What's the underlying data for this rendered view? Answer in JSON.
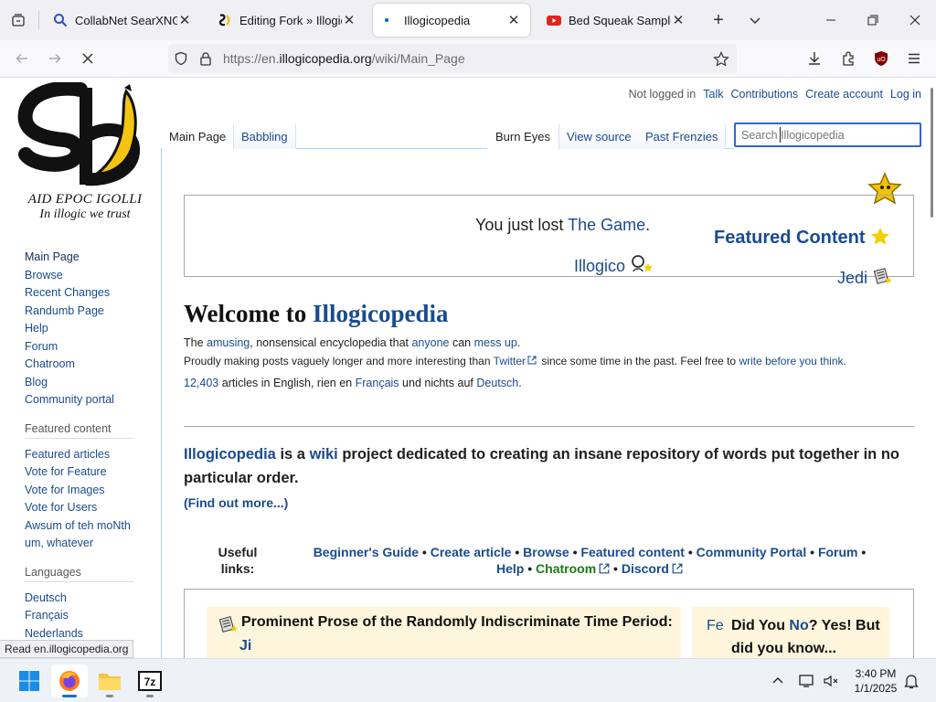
{
  "browser": {
    "tabs": [
      {
        "title": "CollabNet SearXNG",
        "icon": "search-favicon",
        "active": false
      },
      {
        "title": "Editing Fork » Illogicop",
        "icon": "illogicopedia-favicon",
        "active": false
      },
      {
        "title": "Illogicopedia",
        "icon": "loading-dot",
        "active": true
      },
      {
        "title": "Bed Squeak Sample [Je",
        "icon": "youtube-favicon",
        "active": false
      }
    ],
    "url_prefix": "https://en.",
    "url_domain": "illogicopedia.org",
    "url_path": "/wiki/Main_Page",
    "status_text": "Read en.illogicopedia.org"
  },
  "logo": {
    "line1": "AID EPOC IGOLLI",
    "line2": "In illogic we trust"
  },
  "user_links": {
    "not_logged_in": "Not logged in",
    "talk": "Talk",
    "contributions": "Contributions",
    "create_account": "Create account",
    "log_in": "Log in"
  },
  "content_tabs": {
    "main_page": "Main Page",
    "babbling": "Babbling",
    "burn_eyes": "Burn Eyes",
    "view_source": "View source",
    "past_frenzies": "Past Frenzies"
  },
  "search": {
    "placeholder": "Search Illogicopedia"
  },
  "sidebar": {
    "nav": [
      "Main Page",
      "Browse",
      "Recent Changes",
      "Randumb Page",
      "Help",
      "Forum",
      "Chatroom",
      "Blog",
      "Community portal"
    ],
    "featured_heading": "Featured content",
    "featured": [
      "Featured articles",
      "Vote for Feature",
      "Vote for Images",
      "Vote for Users",
      "Awsum of teh moNth",
      "um, whatever"
    ],
    "languages_heading": "Languages",
    "languages": [
      "Deutsch",
      "Français",
      "Nederlands"
    ]
  },
  "banner": {
    "game_prefix": "You just lost ",
    "game_link": "The Game",
    "game_suffix": ".",
    "illogico": "Illogico",
    "featured_content": "Featured Content",
    "jedi": "Jedi"
  },
  "welcome": {
    "prefix": "Welcome to ",
    "site": "Illogicopedia"
  },
  "intro": {
    "l1_a": "The ",
    "l1_amusing": "amusing",
    "l1_b": ", nonsensical encyclopedia that ",
    "l1_anyone": "anyone",
    "l1_c": " can ",
    "l1_messup": "mess up",
    "l1_d": ".",
    "l2_a": "Proudly making posts vaguely longer and more interesting than ",
    "l2_twitter": "Twitter",
    "l2_b": " since some time in the past. Feel free to ",
    "l2_write": "write before you think",
    "l2_c": ".",
    "l3_count": "12,403",
    "l3_a": " articles in English, rien en ",
    "l3_fr": "Français",
    "l3_b": " und nichts auf ",
    "l3_de": "Deutsch",
    "l3_c": "."
  },
  "tagline": {
    "site": "Illogicopedia",
    "a": " is a ",
    "wiki": "wiki",
    "b": " project dedicated to creating an insane repository of words put together in no particular order.",
    "find_out": "(Find out more...)"
  },
  "useful": {
    "label": "Useful links:",
    "links": [
      "Beginner's Guide",
      "Create article",
      "Browse",
      "Featured content",
      "Community Portal",
      "Forum",
      "Help",
      "Chatroom",
      "Discord"
    ]
  },
  "boxes": {
    "prose_title": "Prominent Prose of the Randomly Indiscriminate Time Period:",
    "prose_sub": "Ji",
    "dyk_fe": "Fe",
    "dyk_a": "Did You ",
    "dyk_no": "No",
    "dyk_b": "? Yes! But did you know..."
  },
  "taskbar": {
    "time": "3:40 PM",
    "date": "1/1/2025"
  },
  "colors": {
    "link": "#1a4b8f",
    "green_link": "#1a7a1a",
    "box_bg": "#fdf5dc",
    "search_border": "#3366cc"
  }
}
